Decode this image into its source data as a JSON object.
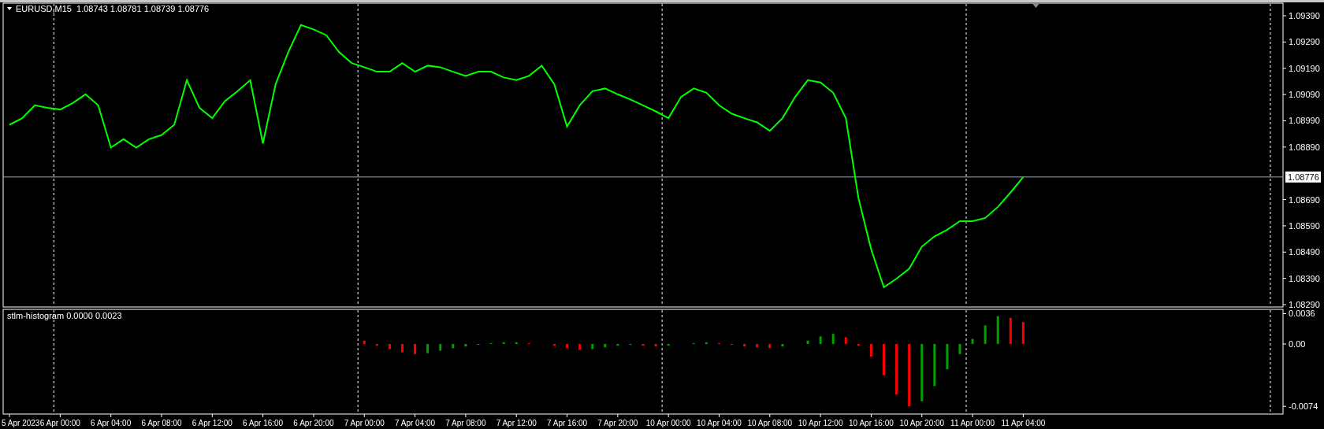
{
  "price_chart": {
    "title": "EURUSD,M15  1.08743 1.08781 1.08739 1.08776",
    "chart_data": {
      "type": "line",
      "grid": true,
      "series": [
        {
          "color": "#00ff00",
          "values": [
            1.08975,
            1.09,
            1.09049,
            1.09039,
            1.09033,
            1.09058,
            1.09091,
            1.09049,
            1.08888,
            1.0892,
            1.08888,
            1.0892,
            1.08936,
            1.08975,
            1.09145,
            1.09039,
            1.09,
            1.09065,
            1.09103,
            1.09145,
            1.08904,
            1.09129,
            1.09252,
            1.09355,
            1.09338,
            1.09316,
            1.09252,
            1.0921,
            1.09194,
            1.09177,
            1.09177,
            1.0921,
            1.09177,
            1.092,
            1.09194,
            1.09177,
            1.09161,
            1.09177,
            1.09177,
            1.09155,
            1.09145,
            1.09161,
            1.092,
            1.09129,
            1.08968,
            1.09049,
            1.09103,
            1.09113,
            1.09091,
            1.09071,
            1.09049,
            1.09026,
            1.09,
            1.09081,
            1.09113,
            1.09097,
            1.09049,
            1.09017,
            1.09,
            1.08984,
            1.08952,
            1.09,
            1.09081,
            1.09145,
            1.09136,
            1.09097,
            1.09,
            1.08695,
            1.08501,
            1.08356,
            1.08389,
            1.08427,
            1.08511,
            1.0855,
            1.08575,
            1.08608,
            1.08608,
            1.0862,
            1.08662,
            1.08717,
            1.08776,
            null,
            null,
            null,
            null,
            null,
            null,
            null,
            null,
            null,
            null,
            null,
            null,
            null,
            null,
            null,
            null,
            null,
            null,
            null,
            null
          ]
        }
      ],
      "ylim": [
        1.08281,
        1.09438
      ],
      "yticks": [
        {
          "value": 1.0939,
          "label": "1.09390"
        },
        {
          "value": 1.0929,
          "label": "1.09290"
        },
        {
          "value": 1.0919,
          "label": "1.09190"
        },
        {
          "value": 1.0909,
          "label": "1.09090"
        },
        {
          "value": 1.0899,
          "label": "1.08990"
        },
        {
          "value": 1.0889,
          "label": "1.08890"
        },
        {
          "value": 1.0869,
          "label": "1.08690"
        },
        {
          "value": 1.0859,
          "label": "1.08590"
        },
        {
          "value": 1.0849,
          "label": "1.08490"
        },
        {
          "value": 1.0839,
          "label": "1.08390"
        },
        {
          "value": 1.0829,
          "label": "1.08290"
        }
      ],
      "ref_lines": [
        {
          "axis": "y",
          "value": 1.08776,
          "label": "1.08776"
        }
      ]
    }
  },
  "indicator": {
    "title": "stlm-histogram 0.0000 0.0023",
    "chart_data": {
      "type": "bar",
      "grid": true,
      "categories": [
        "5 Apr 2023",
        null,
        null,
        null,
        "6 Apr 00:00",
        null,
        null,
        null,
        "6 Apr 04:00",
        null,
        null,
        null,
        "6 Apr 08:00",
        null,
        null,
        null,
        "6 Apr 12:00",
        null,
        null,
        null,
        "6 Apr 16:00",
        null,
        null,
        null,
        "6 Apr 20:00",
        null,
        null,
        null,
        "7 Apr 00:00",
        null,
        null,
        null,
        "7 Apr 04:00",
        null,
        null,
        null,
        "7 Apr 08:00",
        null,
        null,
        null,
        "7 Apr 12:00",
        null,
        null,
        null,
        "7 Apr 16:00",
        null,
        null,
        null,
        "7 Apr 20:00",
        null,
        null,
        null,
        "10 Apr 00:00",
        null,
        null,
        null,
        "10 Apr 04:00",
        null,
        null,
        null,
        "10 Apr 08:00",
        null,
        null,
        null,
        "10 Apr 12:00",
        null,
        null,
        null,
        "10 Apr 16:00",
        null,
        null,
        null,
        "10 Apr 20:00",
        null,
        null,
        null,
        "11 Apr 00:00",
        null,
        null,
        null,
        "11 Apr 04:00",
        null,
        null,
        null,
        null,
        null,
        null,
        null,
        null,
        null,
        null,
        null,
        null,
        null,
        null,
        null,
        null,
        null,
        null,
        null,
        null
      ],
      "series": [
        {
          "color": "#ff0000",
          "values": [
            null,
            null,
            null,
            null,
            null,
            null,
            null,
            null,
            null,
            null,
            null,
            null,
            null,
            null,
            null,
            null,
            null,
            null,
            null,
            null,
            null,
            null,
            null,
            null,
            null,
            null,
            null,
            null,
            0.0004,
            -0.0002,
            -0.0006,
            -0.001,
            -0.0012,
            null,
            null,
            null,
            null,
            null,
            null,
            null,
            null,
            0.0001,
            0,
            -0.0002,
            -0.0005,
            -0.0007,
            null,
            null,
            null,
            null,
            -0.0002,
            -0.0003,
            null,
            null,
            null,
            null,
            0.0001,
            -0.0001,
            -0.0003,
            -0.0004,
            -0.0005,
            null,
            null,
            null,
            null,
            null,
            0.0008,
            -0.0002,
            -0.0015,
            -0.0037,
            -0.006,
            -0.0074,
            null,
            null,
            null,
            null,
            null,
            null,
            null,
            0.0031,
            0.0026,
            null,
            null,
            null,
            null,
            null,
            null,
            null,
            null,
            null,
            null,
            null,
            null,
            null,
            null,
            null,
            null,
            null,
            null,
            null,
            null
          ]
        },
        {
          "color": "#00a000",
          "values": [
            null,
            null,
            null,
            null,
            null,
            null,
            null,
            null,
            null,
            null,
            null,
            null,
            null,
            null,
            null,
            null,
            null,
            null,
            null,
            null,
            null,
            null,
            null,
            null,
            null,
            null,
            null,
            null,
            null,
            null,
            null,
            null,
            null,
            -0.0011,
            -0.0008,
            -0.0005,
            -0.0003,
            -0.0001,
            0.0001,
            0.0002,
            0.0002,
            null,
            null,
            null,
            null,
            null,
            -0.0006,
            -0.0004,
            -0.0002,
            -0.0001,
            null,
            null,
            -0.0002,
            0,
            0.0001,
            0.0002,
            null,
            null,
            null,
            null,
            null,
            -0.0003,
            0,
            0.0004,
            0.0009,
            0.0012,
            null,
            null,
            null,
            null,
            null,
            null,
            -0.0068,
            -0.005,
            -0.003,
            -0.0012,
            0.0006,
            0.0022,
            0.0033,
            null,
            null,
            null,
            null,
            null,
            null,
            null,
            null,
            null,
            null,
            null,
            null,
            null,
            null,
            null,
            null,
            null,
            null,
            null,
            null,
            null,
            null
          ]
        }
      ],
      "ylim": [
        -0.00832,
        0.00411
      ],
      "yticks": [
        {
          "value": 0.0036,
          "label": "0.0036"
        },
        {
          "value": 0,
          "label": "0.00"
        },
        {
          "value": -0.0074,
          "label": "-0.0074"
        }
      ]
    }
  }
}
